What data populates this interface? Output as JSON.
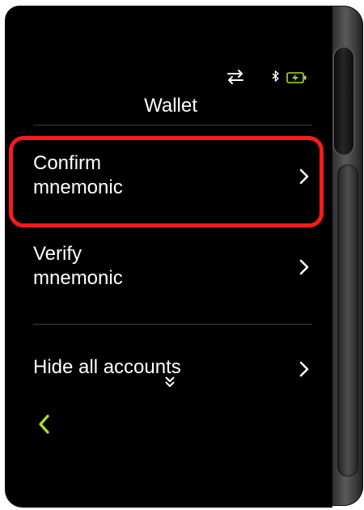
{
  "header": {
    "title": "Wallet"
  },
  "status_bar": {
    "icons": [
      "transfer-icon",
      "bluetooth-icon",
      "battery-charging-icon"
    ],
    "accent_color": "#a6e22e"
  },
  "menu": {
    "items": [
      {
        "label": "Confirm\nmnemonic",
        "highlighted": true
      },
      {
        "label": "Verify\nmnemonic",
        "highlighted": false
      },
      {
        "label": "Hide all accounts",
        "highlighted": false
      }
    ]
  },
  "navigation": {
    "back_icon": "chevron-left-icon",
    "scroll_icon": "double-chevron-down-icon"
  },
  "colors": {
    "background": "#000000",
    "text": "#ffffff",
    "highlight": "#ff1a1a",
    "accent": "#a6e22e"
  }
}
